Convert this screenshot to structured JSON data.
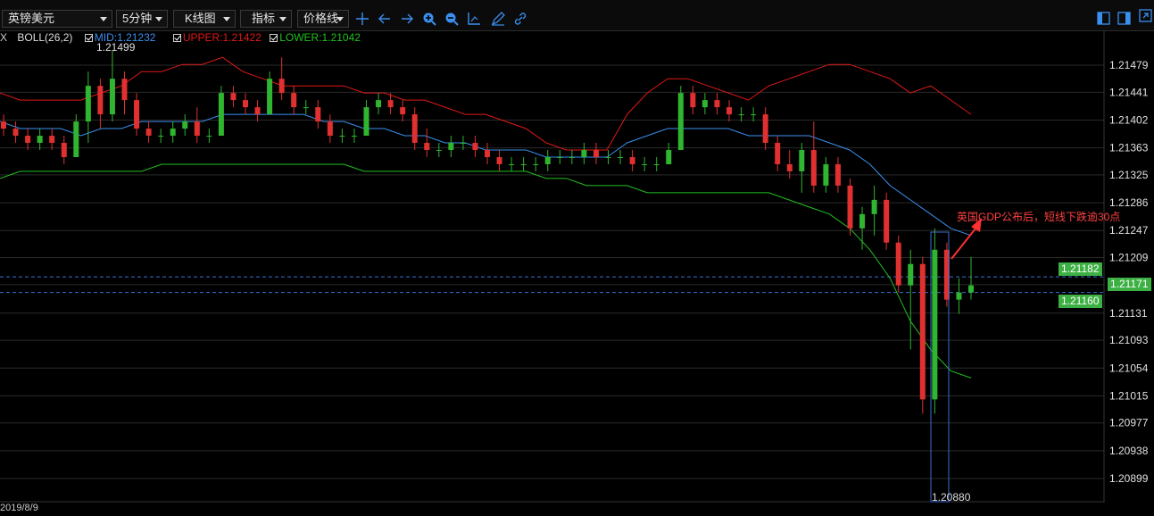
{
  "toolbar": {
    "symbol": "英镑美元",
    "period": "5分钟",
    "chart_type": "K线图",
    "indicator": "指标",
    "price_line": "价格线",
    "icons": [
      "crosshair-icon",
      "arrow-left-icon",
      "arrow-right-icon",
      "zoom-in-icon",
      "zoom-out-icon",
      "draw-axis-icon",
      "pencil-icon",
      "link-icon",
      "layout-left-icon",
      "layout-right-icon",
      "expand-icon"
    ]
  },
  "indicator_row": {
    "prefix": "X",
    "name": "BOLL(26,2)",
    "mid": "MID:1.21232",
    "upper": "UPPER:1.21422",
    "lower": "LOWER:1.21042",
    "colors": {
      "mid": "#3a8ff0",
      "upper": "#e01818",
      "lower": "#20c020"
    }
  },
  "price_tags": {
    "upper_dash": "1.21182",
    "current": "1.21171",
    "lower_dash": "1.21160"
  },
  "annotation": "英国GDP公布后，短线下跌逾30点",
  "labels": {
    "max": "1.21499",
    "min": "1.20880",
    "date": "2019/8/9"
  },
  "chart_data": {
    "type": "line",
    "instrument": "英镑美元",
    "ylim": [
      1.2088,
      1.215
    ],
    "y_ticks": [
      "1.21479",
      "1.21441",
      "1.21402",
      "1.21363",
      "1.21325",
      "1.21286",
      "1.21247",
      "1.21209",
      "1.21171",
      "1.21131",
      "1.21093",
      "1.21054",
      "1.21015",
      "1.20977",
      "1.20938",
      "1.20899"
    ],
    "series": [
      {
        "name": "UPPER",
        "color": "#e01818",
        "y": [
          1.2144,
          1.2143,
          1.2143,
          1.2143,
          1.2143,
          1.2144,
          1.2145,
          1.2147,
          1.2147,
          1.2148,
          1.2148,
          1.2149,
          1.2147,
          1.2146,
          1.2145,
          1.2145,
          1.2145,
          1.2145,
          1.2144,
          1.2144,
          1.2143,
          1.2143,
          1.2142,
          1.2141,
          1.2141,
          1.214,
          1.2139,
          1.2137,
          1.2136,
          1.2136,
          1.2136,
          1.2141,
          1.2144,
          1.2146,
          1.2146,
          1.2145,
          1.2144,
          1.2143,
          1.2145,
          1.2146,
          1.2147,
          1.2148,
          1.2148,
          1.2147,
          1.2146,
          1.2144,
          1.2145,
          1.2143,
          1.2141
        ]
      },
      {
        "name": "MID",
        "color": "#3a8ff0",
        "y": [
          1.214,
          1.2139,
          1.2139,
          1.2139,
          1.2138,
          1.2139,
          1.2139,
          1.214,
          1.214,
          1.214,
          1.214,
          1.2141,
          1.2141,
          1.2141,
          1.2141,
          1.2141,
          1.214,
          1.214,
          1.2139,
          1.2139,
          1.2138,
          1.2138,
          1.2137,
          1.2137,
          1.2136,
          1.2136,
          1.2136,
          1.2135,
          1.2135,
          1.2135,
          1.2135,
          1.2137,
          1.2138,
          1.2139,
          1.2139,
          1.2139,
          1.2139,
          1.2138,
          1.2138,
          1.2138,
          1.2138,
          1.2137,
          1.2136,
          1.2134,
          1.2131,
          1.2129,
          1.2127,
          1.2125,
          1.2124
        ]
      },
      {
        "name": "LOWER",
        "color": "#20c020",
        "y": [
          1.2132,
          1.2133,
          1.2133,
          1.2133,
          1.2133,
          1.2133,
          1.2133,
          1.2133,
          1.2134,
          1.2134,
          1.2134,
          1.2134,
          1.2134,
          1.2134,
          1.2134,
          1.2134,
          1.2134,
          1.2134,
          1.2133,
          1.2133,
          1.2133,
          1.2133,
          1.2133,
          1.2133,
          1.2133,
          1.2133,
          1.2133,
          1.2132,
          1.2132,
          1.2131,
          1.2131,
          1.2131,
          1.213,
          1.213,
          1.213,
          1.213,
          1.213,
          1.213,
          1.213,
          1.2129,
          1.2128,
          1.2127,
          1.2125,
          1.2122,
          1.2118,
          1.2112,
          1.2108,
          1.2105,
          1.2104
        ]
      }
    ],
    "candles_ohlc": [
      [
        1.214,
        1.2141,
        1.2138,
        1.2139
      ],
      [
        1.2139,
        1.214,
        1.2137,
        1.2138
      ],
      [
        1.2138,
        1.2139,
        1.2136,
        1.2137
      ],
      [
        1.2137,
        1.2139,
        1.2136,
        1.2138
      ],
      [
        1.2138,
        1.2139,
        1.2136,
        1.2137
      ],
      [
        1.2137,
        1.2138,
        1.2134,
        1.2135
      ],
      [
        1.2135,
        1.2141,
        1.2135,
        1.214
      ],
      [
        1.214,
        1.2147,
        1.2137,
        1.2145
      ],
      [
        1.2145,
        1.2146,
        1.2139,
        1.2141
      ],
      [
        1.2141,
        1.215,
        1.214,
        1.2146
      ],
      [
        1.2146,
        1.2147,
        1.2141,
        1.2143
      ],
      [
        1.2143,
        1.2144,
        1.2138,
        1.2139
      ],
      [
        1.2139,
        1.214,
        1.2137,
        1.2138
      ],
      [
        1.2138,
        1.2139,
        1.2137,
        1.2138
      ],
      [
        1.2138,
        1.214,
        1.2137,
        1.2139
      ],
      [
        1.2139,
        1.2141,
        1.2138,
        1.214
      ],
      [
        1.214,
        1.2142,
        1.2137,
        1.2138
      ],
      [
        1.2138,
        1.2139,
        1.2137,
        1.2138
      ],
      [
        1.2138,
        1.2145,
        1.2138,
        1.2144
      ],
      [
        1.2144,
        1.2145,
        1.2142,
        1.2143
      ],
      [
        1.2143,
        1.2144,
        1.2141,
        1.2142
      ],
      [
        1.2142,
        1.2143,
        1.214,
        1.2141
      ],
      [
        1.2141,
        1.2147,
        1.2141,
        1.2146
      ],
      [
        1.2146,
        1.2149,
        1.2143,
        1.2144
      ],
      [
        1.2144,
        1.2145,
        1.2141,
        1.2142
      ],
      [
        1.2142,
        1.2143,
        1.2141,
        1.2142
      ],
      [
        1.2142,
        1.2143,
        1.2139,
        1.214
      ],
      [
        1.214,
        1.2141,
        1.2137,
        1.2138
      ],
      [
        1.2138,
        1.2139,
        1.2137,
        1.2138
      ],
      [
        1.2138,
        1.2139,
        1.2137,
        1.2138
      ],
      [
        1.2138,
        1.2143,
        1.2138,
        1.2142
      ],
      [
        1.2142,
        1.2144,
        1.2141,
        1.2143
      ],
      [
        1.2143,
        1.2144,
        1.2141,
        1.2142
      ],
      [
        1.2142,
        1.2143,
        1.214,
        1.2141
      ],
      [
        1.2141,
        1.2142,
        1.2136,
        1.2137
      ],
      [
        1.2137,
        1.2139,
        1.2135,
        1.2136
      ],
      [
        1.2136,
        1.2137,
        1.2135,
        1.2136
      ],
      [
        1.2136,
        1.2138,
        1.2135,
        1.2137
      ],
      [
        1.2137,
        1.2138,
        1.2136,
        1.2137
      ],
      [
        1.2137,
        1.2138,
        1.2135,
        1.2136
      ],
      [
        1.2136,
        1.2137,
        1.2134,
        1.2135
      ],
      [
        1.2135,
        1.2136,
        1.2133,
        1.2134
      ],
      [
        1.2134,
        1.2135,
        1.2133,
        1.2134
      ],
      [
        1.2134,
        1.2135,
        1.2133,
        1.2134
      ],
      [
        1.2134,
        1.2135,
        1.2133,
        1.2134
      ],
      [
        1.2134,
        1.2136,
        1.2133,
        1.2135
      ],
      [
        1.2135,
        1.2136,
        1.2134,
        1.2135
      ],
      [
        1.2135,
        1.2136,
        1.2134,
        1.2135
      ],
      [
        1.2135,
        1.2137,
        1.2134,
        1.2136
      ],
      [
        1.2136,
        1.2137,
        1.2134,
        1.2135
      ],
      [
        1.2135,
        1.2136,
        1.2134,
        1.2135
      ],
      [
        1.2135,
        1.2136,
        1.2134,
        1.2135
      ],
      [
        1.2135,
        1.2136,
        1.2133,
        1.2134
      ],
      [
        1.2134,
        1.2135,
        1.2133,
        1.2134
      ],
      [
        1.2134,
        1.2135,
        1.2133,
        1.2134
      ],
      [
        1.2134,
        1.2137,
        1.2134,
        1.2136
      ],
      [
        1.2136,
        1.2145,
        1.2136,
        1.2144
      ],
      [
        1.2144,
        1.2145,
        1.2141,
        1.2142
      ],
      [
        1.2142,
        1.2144,
        1.2141,
        1.2143
      ],
      [
        1.2143,
        1.2144,
        1.2141,
        1.2142
      ],
      [
        1.2142,
        1.2143,
        1.214,
        1.2141
      ],
      [
        1.2141,
        1.2142,
        1.214,
        1.2141
      ],
      [
        1.2141,
        1.2142,
        1.214,
        1.2141
      ],
      [
        1.2141,
        1.2142,
        1.2136,
        1.2137
      ],
      [
        1.2137,
        1.2138,
        1.2133,
        1.2134
      ],
      [
        1.2134,
        1.2136,
        1.2132,
        1.2133
      ],
      [
        1.2133,
        1.2137,
        1.213,
        1.2136
      ],
      [
        1.2136,
        1.214,
        1.213,
        1.2131
      ],
      [
        1.2131,
        1.2135,
        1.213,
        1.2134
      ],
      [
        1.2134,
        1.2135,
        1.213,
        1.2131
      ],
      [
        1.2131,
        1.2132,
        1.2124,
        1.2125
      ],
      [
        1.2125,
        1.2128,
        1.2122,
        1.2127
      ],
      [
        1.2127,
        1.2131,
        1.2124,
        1.2129
      ],
      [
        1.2129,
        1.213,
        1.2122,
        1.2123
      ],
      [
        1.2123,
        1.2124,
        1.2116,
        1.2117
      ],
      [
        1.2117,
        1.2122,
        1.2108,
        1.212
      ],
      [
        1.212,
        1.2121,
        1.2099,
        1.2101
      ],
      [
        1.2101,
        1.2125,
        1.2099,
        1.2122
      ],
      [
        1.2122,
        1.2123,
        1.2114,
        1.2115
      ],
      [
        1.2115,
        1.2118,
        1.2113,
        1.2116
      ],
      [
        1.2116,
        1.2121,
        1.2115,
        1.2117
      ]
    ]
  }
}
